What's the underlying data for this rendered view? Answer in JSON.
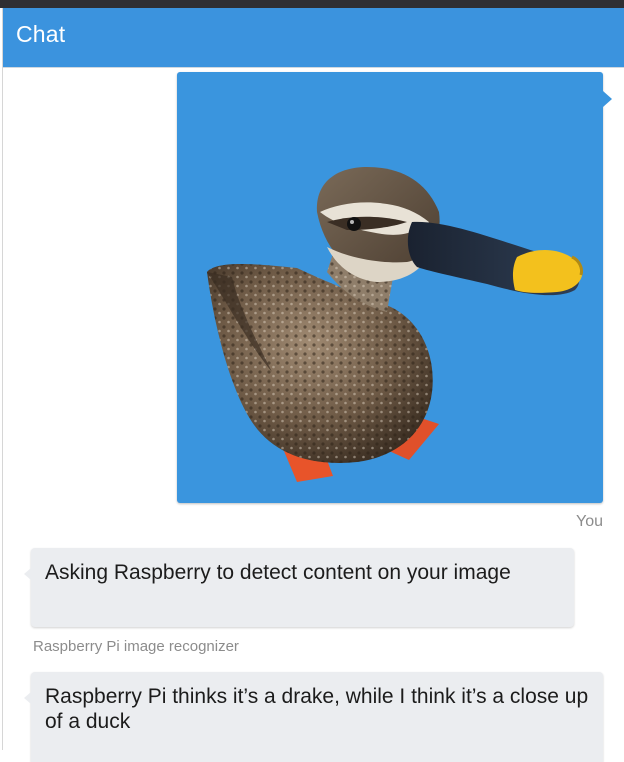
{
  "header": {
    "title": "Chat"
  },
  "messages": [
    {
      "type": "image",
      "image_subject": "duck",
      "author": "You"
    },
    {
      "type": "text",
      "text": "Asking Raspberry to detect content on your image",
      "author": "Raspberry Pi image recognizer"
    },
    {
      "type": "text",
      "text": "Raspberry Pi thinks it’s a drake, while I think it’s a close up of a duck",
      "author": ""
    }
  ],
  "colors": {
    "header_bg": "#3b93de",
    "image_bubble_bg": "#3a95de",
    "bot_bubble_bg": "#ebedf0",
    "meta_text": "#8c8c8c"
  }
}
